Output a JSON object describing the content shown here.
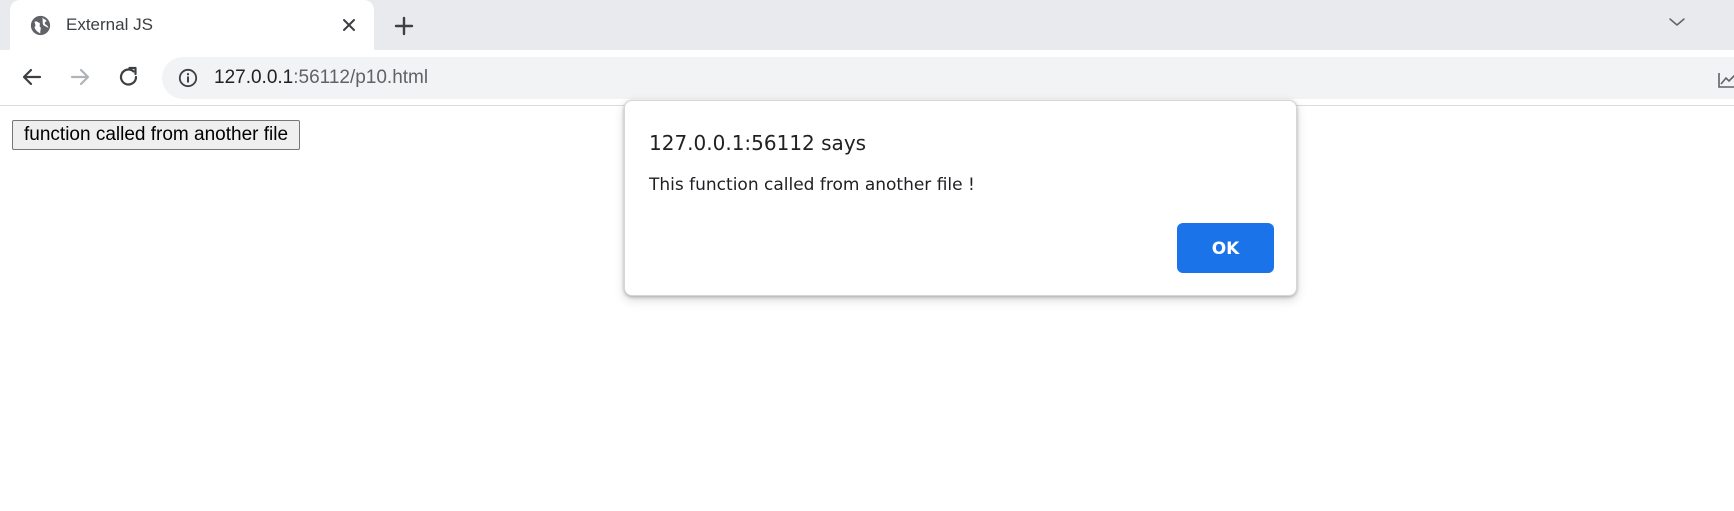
{
  "browser": {
    "tab": {
      "title": "External JS",
      "favicon": "globe-icon",
      "close_icon": "close-icon"
    },
    "new_tab_icon": "plus-icon",
    "tab_search_icon": "chevron-down-icon",
    "toolbar": {
      "back_icon": "back-arrow-icon",
      "forward_icon": "forward-arrow-icon",
      "reload_icon": "reload-icon",
      "site_info_icon": "info-icon",
      "url_host": "127.0.0.1",
      "url_rest": ":56112/p10.html"
    }
  },
  "page": {
    "button_label": "function called from another file"
  },
  "dialog": {
    "title": "127.0.0.1:56112 says",
    "message": "This function called from another file !",
    "ok_label": "OK"
  },
  "colors": {
    "accent": "#1a73e8",
    "tabstrip": "#e8eaed",
    "omnibox": "#f1f3f4"
  }
}
